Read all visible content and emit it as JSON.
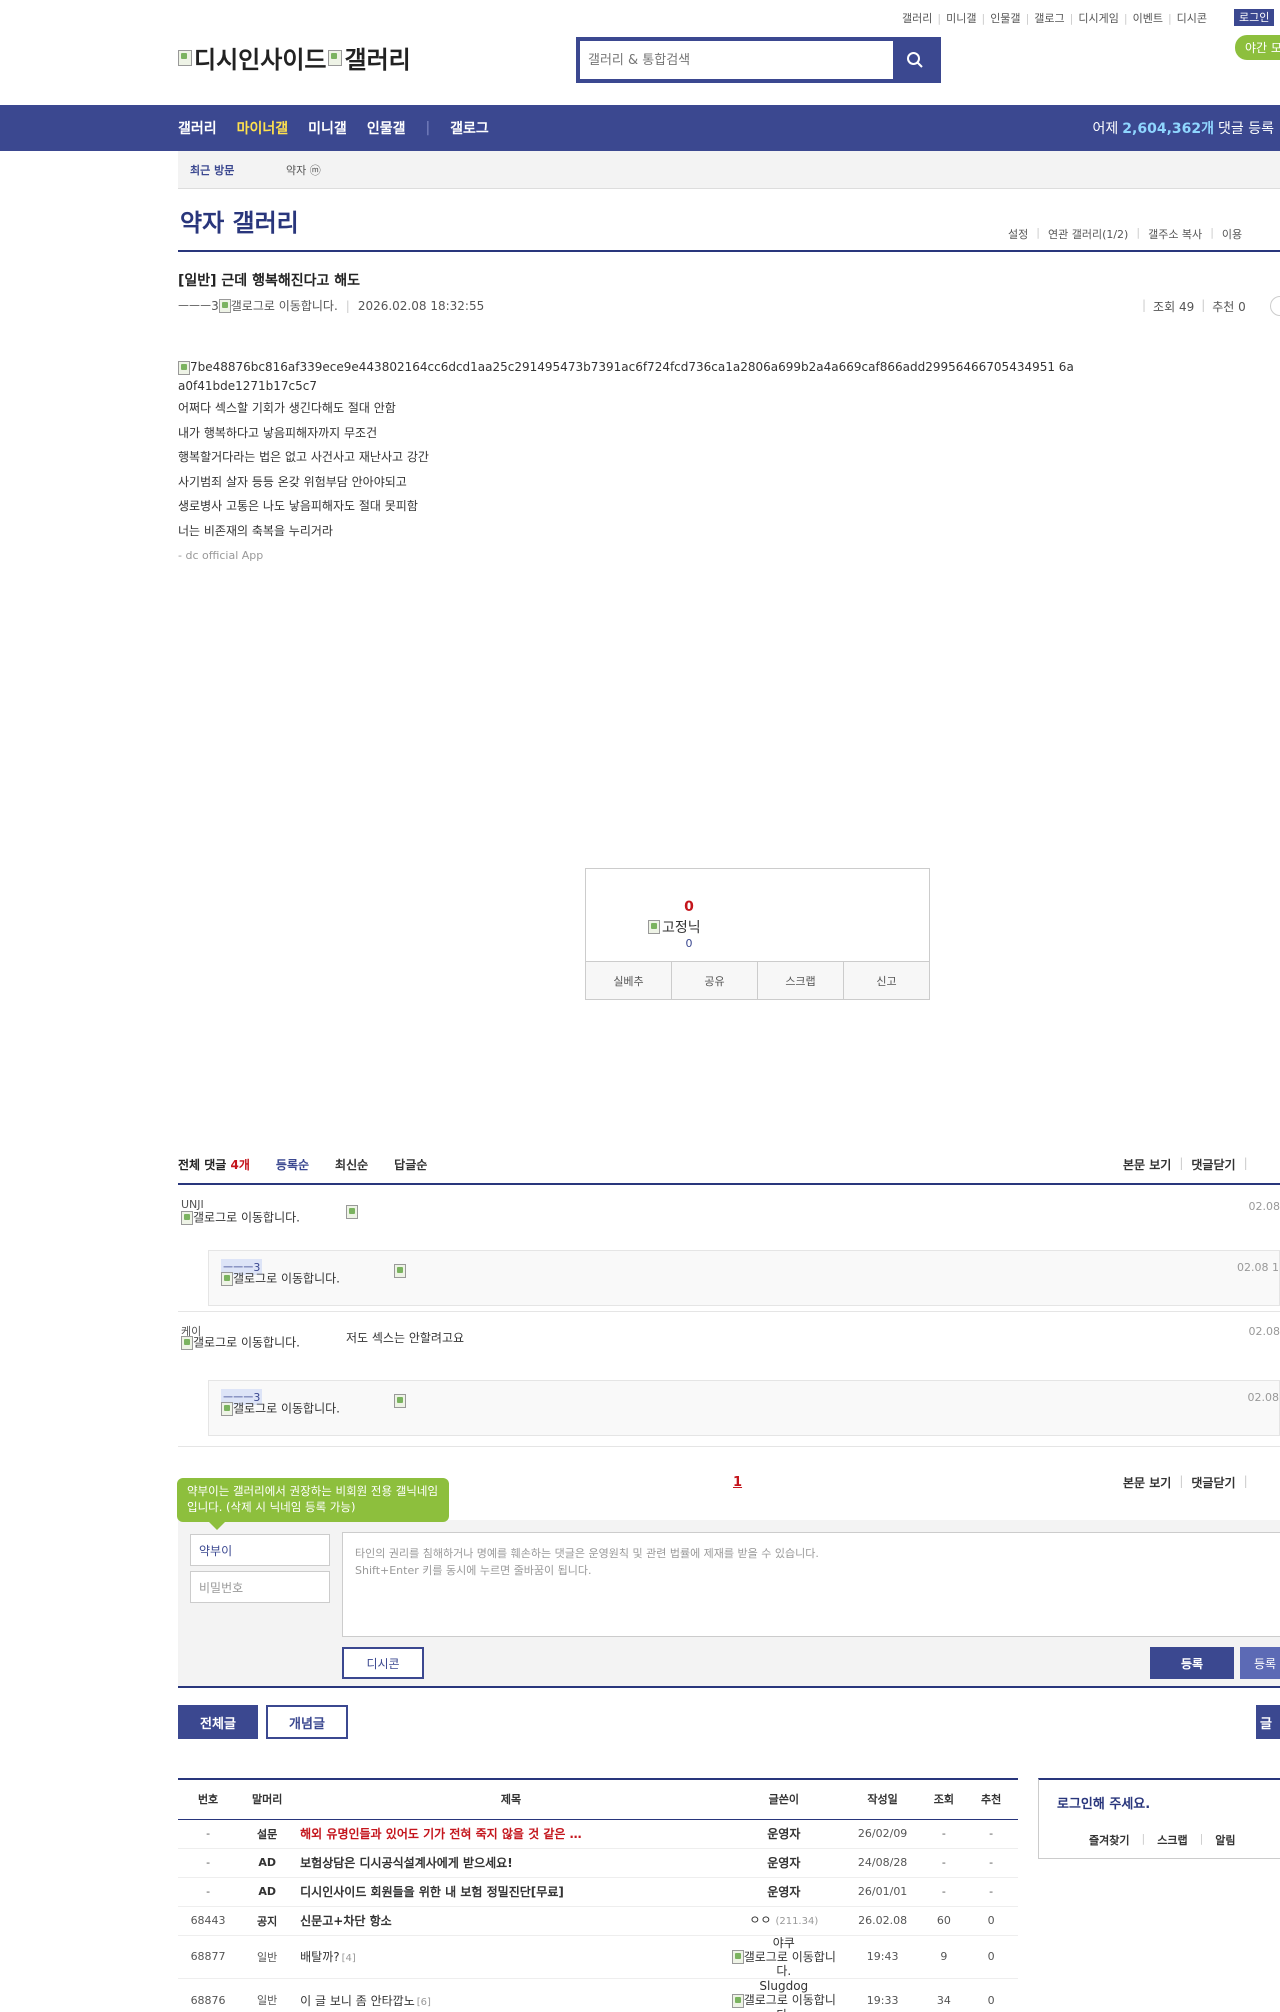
{
  "top_links": [
    "갤러리",
    "미니갤",
    "인물갤",
    "갤로그",
    "디시게임",
    "이벤트",
    "디시콘"
  ],
  "login_label": "로그인",
  "night_mode_label": "야간 모",
  "logo": {
    "part1": "디시인사이드",
    "part2": "갤러리"
  },
  "search": {
    "placeholder": "갤러리 & 통합검색",
    "icon": "search-icon"
  },
  "gnb": {
    "items": [
      "갤러리",
      "마이너갤",
      "미니갤",
      "인물갤",
      "갤로그"
    ],
    "active_index": 1,
    "stats_prefix": "어제",
    "stats_count": "2,604,362개",
    "stats_suffix": "댓글 등록"
  },
  "recent": {
    "label": "최근 방문",
    "item": "약자",
    "item_badge": "ⓜ"
  },
  "gallery": {
    "title": "약자 갤러리",
    "tools": [
      "설정",
      "연관 갤러리(1/2)",
      "갤주소 복사",
      "이용"
    ]
  },
  "post": {
    "title": "[일반] 근데 행복해진다고 해도",
    "author": "ㅡㅡㅡ3",
    "author_alt": "갤로그로 이동합니다.",
    "date": "2026.02.08 18:32:55",
    "views_label": "조회 49",
    "recom_label": "추천 0",
    "image_alt": "7be48876bc816af339ece9e443802164cc6dcd1aa25c291495473b7391ac6f724fcd736ca1a2806a699b2a4a669caf866add29956466705434951 6aa0f41bde1271b17c5c7",
    "lines": [
      "어쩌다 섹스할 기회가 생긴다해도 절대 안함",
      "내가 행복하다고 낳음피해자까지 무조건",
      "행복할거다라는 법은 없고 사건사고 재난사고 강간",
      "사기범죄 살자 등등 온갖 위험부담 안아야되고",
      "생로병사 고통은 나도 낳음피해자도 절대 못피함",
      "너는 비존재의 축복을 누리거라"
    ],
    "app_sig": "- dc official App"
  },
  "recommend": {
    "count": "0",
    "fixed_alt": "고정닉",
    "fixed_count": "0",
    "buttons": [
      "실베추",
      "공유",
      "스크랩",
      "신고"
    ]
  },
  "comments": {
    "total_label": "전체 댓글",
    "total_count": "4개",
    "sort": [
      "등록순",
      "최신순",
      "답글순"
    ],
    "right_links": [
      "본문 보기",
      "댓글닫기"
    ],
    "items": [
      {
        "nick": "UNJI",
        "alt": "갤로그로 이동합니다.",
        "text": "",
        "date": "02.08",
        "reply": false
      },
      {
        "nick": "ㅡㅡㅡ3",
        "alt": "갤로그로 이동합니다.",
        "text": "",
        "date": "02.08 1",
        "reply": true
      },
      {
        "nick": "케이",
        "alt": "갤로그로 이동합니다.",
        "text": "저도 섹스는 안할려고요",
        "date": "02.08",
        "reply": false
      },
      {
        "nick": "ㅡㅡㅡ3",
        "alt": "갤로그로 이동합니다.",
        "text": "",
        "date": "02.08",
        "reply": true
      }
    ],
    "page": "1"
  },
  "write": {
    "tooltip": "약부이는 갤러리에서 권장하는 비회원 전용 갤닉네임입니다. (삭제 시 닉네임 등록 가능)",
    "name_value": "약부이",
    "password_placeholder": "비밀번호",
    "memo_placeholder_1": "타인의 권리를 침해하거나 명예를 훼손하는 댓글은 운영원칙 및 관련 법률에 제재를 받을 수 있습니다.",
    "memo_placeholder_2": "Shift+Enter 키를 동시에 누르면 줄바꿈이 됩니다.",
    "dccon_label": "디시콘",
    "submit_label": "등록",
    "submit_recom_label": "등록"
  },
  "list_buttons": {
    "all": "전체글",
    "concept": "개념글",
    "write": "글"
  },
  "table": {
    "headers": [
      "번호",
      "말머리",
      "제목",
      "글쓴이",
      "작성일",
      "조회",
      "추천"
    ],
    "rows": [
      {
        "no": "-",
        "head": "설문",
        "subject": "해외 유명인들과 있어도 기가 전혀 죽지 않을 것 같은 …",
        "writer": "운영자",
        "ip": "",
        "date": "26/02/09",
        "views": "-",
        "recom": "-",
        "notice": true,
        "red": true,
        "reply": ""
      },
      {
        "no": "-",
        "head": "AD",
        "subject": "보험상담은 디시공식설계사에게 받으세요!",
        "writer": "운영자",
        "ip": "",
        "date": "24/08/28",
        "views": "-",
        "recom": "-",
        "notice": true,
        "red": false,
        "reply": ""
      },
      {
        "no": "-",
        "head": "AD",
        "subject": "디시인사이드 회원들을 위한 내 보험 정밀진단[무료]",
        "writer": "운영자",
        "ip": "",
        "date": "26/01/01",
        "views": "-",
        "recom": "-",
        "notice": true,
        "red": false,
        "reply": ""
      },
      {
        "no": "68443",
        "head": "공지",
        "subject": "신문고+차단 항소",
        "writer": "ㅇㅇ",
        "ip": "(211.34)",
        "date": "26.02.08",
        "views": "60",
        "recom": "0",
        "notice": true,
        "red": false,
        "reply": ""
      },
      {
        "no": "68877",
        "head": "일반",
        "subject": "배탈까?",
        "writer": "야쿠",
        "ip": "",
        "date": "19:43",
        "views": "9",
        "recom": "0",
        "notice": false,
        "red": false,
        "reply": "[4]",
        "alt": "갤로그로 이동합니다."
      },
      {
        "no": "68876",
        "head": "일반",
        "subject": "이 글 보니 좀 안타깝노",
        "writer": "Slugdog",
        "ip": "",
        "date": "19:33",
        "views": "34",
        "recom": "0",
        "notice": false,
        "red": false,
        "reply": "[6]",
        "alt": "갤로그로 이동합니다."
      }
    ]
  },
  "login_box": {
    "title": "로그인해 주세요.",
    "links": [
      "즐겨찾기",
      "스크랩",
      "알림"
    ]
  },
  "colors": {
    "brand": "#3b4890",
    "accent_yellow": "#ffe14d",
    "green": "#8dbf3d",
    "red": "#c4151c"
  }
}
